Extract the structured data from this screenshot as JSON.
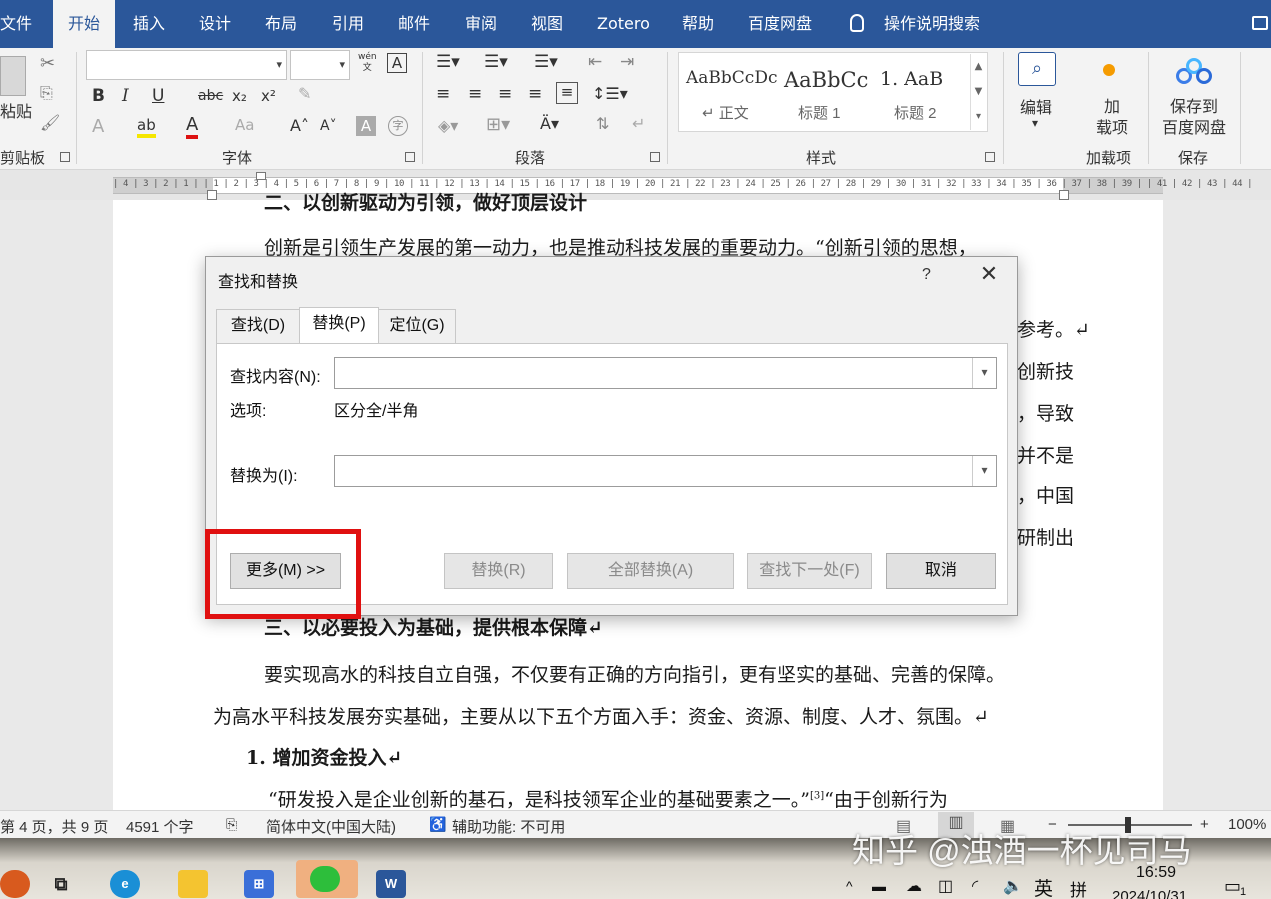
{
  "ribbon_tabs": [
    "文件",
    "开始",
    "插入",
    "设计",
    "布局",
    "引用",
    "邮件",
    "审阅",
    "视图",
    "Zotero",
    "帮助",
    "百度网盘"
  ],
  "search_label": "操作说明搜索",
  "groups": {
    "clipboard": "剪贴板",
    "font": "字体",
    "paragraph": "段落",
    "styles": "样式",
    "addins": "加载项",
    "save": "保存"
  },
  "clipboard": {
    "paste": "粘贴"
  },
  "font_tools": {
    "bold": "B",
    "italic": "I",
    "underline": "U",
    "strike": "abc",
    "subscript": "x₂",
    "superscript": "x²",
    "grow": "A˄",
    "shrink": "A˅",
    "case": "Aa",
    "shade": "A",
    "phonetic": "wén\n文",
    "border": "A"
  },
  "styles": [
    {
      "sample": "AaBbCcDc",
      "name": "↵ 正文"
    },
    {
      "sample": "AaBbCc",
      "name": "标题 1"
    },
    {
      "sample": "1.  AaB",
      "name": "标题 2"
    }
  ],
  "editing": {
    "label": "编辑"
  },
  "addin": {
    "label": "加\n载项"
  },
  "baidu_save": {
    "label": "保存到\n百度网盘"
  },
  "ruler_text": "| 4 | 3 | 2 | 1 |    | 1 | 2 | 3 | 4 | 5 | 6 | 7 | 8 | 9 | 10 | 11 | 12 | 13 | 14 | 15 | 16 | 17 | 18 | 19 | 20 | 21 | 22 | 23 | 24 | 25 | 26 | 27 | 28 | 29 | 30 | 31 | 32 | 33 | 34 | 35 | 36 | 37 | 38 | 39 |    | 41 | 42 | 43 | 44 |",
  "document": {
    "line_top": "二、以创新驱动为引领，做好顶层设计",
    "line1": "创新是引领生产发展的第一动力，也是推动科技发展的重要动力。“创新引领的思想，",
    "right_fragments": [
      "参考。↵",
      "创新技",
      "，导致",
      "并不是",
      "，中国",
      "研制出"
    ],
    "heading3": "三、以必要投入为基础，提供根本保障↵",
    "para1": "要实现高水的科技自立自强，不仅要有正确的方向指引，更有坚实的基础、完善的保障。",
    "para2": "为高水平科技发展夯实基础，主要从以下五个方面入手：资金、资源、制度、人才、氛围。↵",
    "sub1": "1.  增加资金投入↵",
    "para3": "“研发投入是企业创新的基石，是科技领军企业的基础要素之一。”",
    "para3_ref": "[3]",
    "para3_tail": "“由于创新行为"
  },
  "dialog": {
    "title": "查找和替换",
    "help": "?",
    "tabs": [
      "查找(D)",
      "替换(P)",
      "定位(G)"
    ],
    "find_label": "查找内容(N):",
    "find_value": "",
    "options_label": "选项:",
    "options_value": "区分全/半角",
    "replace_label": "替换为(I):",
    "replace_value": "",
    "buttons": {
      "more": "更多(M) >>",
      "replace": "替换(R)",
      "replace_all": "全部替换(A)",
      "find_next": "查找下一处(F)",
      "cancel": "取消"
    }
  },
  "statusbar": {
    "page": "第 4 页，共 9 页",
    "words": "4591 个字",
    "language": "简体中文(中国大陆)",
    "accessibility": "辅助功能: 不可用",
    "zoom": "100%",
    "zoom_minus": "−",
    "zoom_plus": "+"
  },
  "taskbar": {
    "tray_lang": "英",
    "tray_ime": "拼",
    "time": "16:59",
    "date": "2024/10/31",
    "notif_count": "1"
  },
  "watermark": "知乎 @浊酒一杯见司马"
}
